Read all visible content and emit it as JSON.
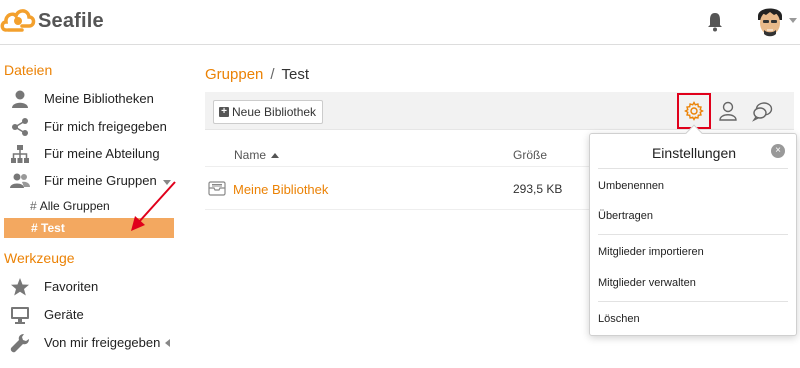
{
  "header": {
    "app_name": "Seafile",
    "logo_icon": "seafile-cloud-logo",
    "bell_icon": "bell-icon",
    "avatar_icon": "user-avatar"
  },
  "sidebar": {
    "files_heading": "Dateien",
    "items": [
      {
        "label": "Meine Bibliotheken",
        "icon": "user-icon"
      },
      {
        "label": "Für mich freigegeben",
        "icon": "share-icon"
      },
      {
        "label": "Für meine Abteilung",
        "icon": "org-chart-icon"
      },
      {
        "label": "Für meine Gruppen",
        "icon": "group-icon"
      }
    ],
    "groups": [
      {
        "label": "Alle Gruppen"
      },
      {
        "label": "Test"
      }
    ],
    "tools_heading": "Werkzeuge",
    "tools": [
      {
        "label": "Favoriten",
        "icon": "star-icon"
      },
      {
        "label": "Geräte",
        "icon": "monitor-icon"
      },
      {
        "label": "Von mir freigegeben",
        "icon": "wrench-icon"
      }
    ],
    "hash": "#"
  },
  "breadcrumb": {
    "parent": "Gruppen",
    "separator": "/",
    "current": "Test"
  },
  "toolbar": {
    "new_library_label": "Neue Bibliothek"
  },
  "table": {
    "col_name": "Name",
    "col_size": "Größe",
    "rows": [
      {
        "name": "Meine Bibliothek",
        "size": "293,5 KB"
      }
    ]
  },
  "popover": {
    "title": "Einstellungen",
    "close": "×",
    "items": [
      "Umbenennen",
      "Übertragen",
      "Mitglieder importieren",
      "Mitglieder verwalten",
      "Löschen"
    ]
  },
  "colors": {
    "accent": "#eb8205",
    "highlight": "#f3a860",
    "annotation": "#e0001b"
  }
}
